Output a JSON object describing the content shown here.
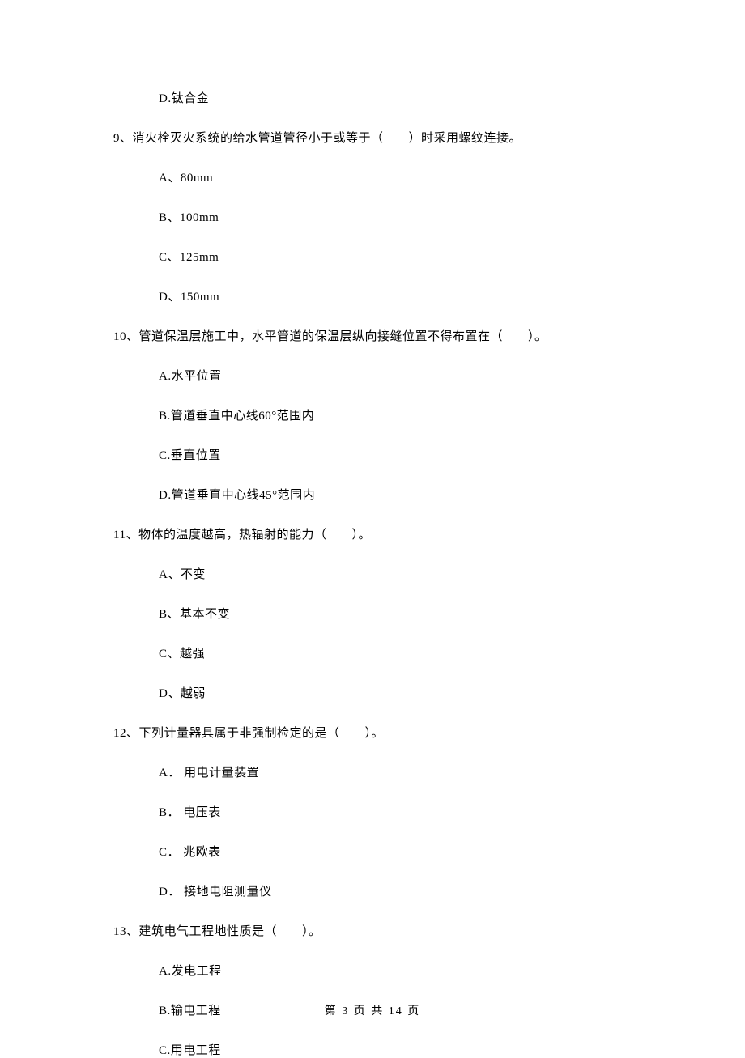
{
  "items": [
    {
      "type": "option",
      "text": "D.钛合金"
    },
    {
      "type": "question",
      "text": "9、消火栓灭火系统的给水管道管径小于或等于（　　）时采用螺纹连接。"
    },
    {
      "type": "option",
      "text": "A、80mm"
    },
    {
      "type": "option",
      "text": "B、100mm"
    },
    {
      "type": "option",
      "text": "C、125mm"
    },
    {
      "type": "option",
      "text": "D、150mm"
    },
    {
      "type": "question",
      "text": "10、管道保温层施工中，水平管道的保温层纵向接缝位置不得布置在（　　）。"
    },
    {
      "type": "option",
      "text": "A.水平位置"
    },
    {
      "type": "option",
      "text": "B.管道垂直中心线60°范围内"
    },
    {
      "type": "option",
      "text": "C.垂直位置"
    },
    {
      "type": "option",
      "text": "D.管道垂直中心线45°范围内"
    },
    {
      "type": "question",
      "text": "11、物体的温度越高，热辐射的能力（　　）。"
    },
    {
      "type": "option",
      "text": "A、不变"
    },
    {
      "type": "option",
      "text": "B、基本不变"
    },
    {
      "type": "option",
      "text": "C、越强"
    },
    {
      "type": "option",
      "text": "D、越弱"
    },
    {
      "type": "question",
      "text": "12、下列计量器具属于非强制检定的是（　　）。"
    },
    {
      "type": "option",
      "text": "A． 用电计量装置"
    },
    {
      "type": "option",
      "text": "B． 电压表"
    },
    {
      "type": "option",
      "text": "C． 兆欧表"
    },
    {
      "type": "option",
      "text": "D． 接地电阻测量仪"
    },
    {
      "type": "question",
      "text": "13、建筑电气工程地性质是（　　）。"
    },
    {
      "type": "option",
      "text": "A.发电工程"
    },
    {
      "type": "option",
      "text": "B.输电工程"
    },
    {
      "type": "option",
      "text": "C.用电工程"
    }
  ],
  "footer": "第 3 页 共 14 页"
}
